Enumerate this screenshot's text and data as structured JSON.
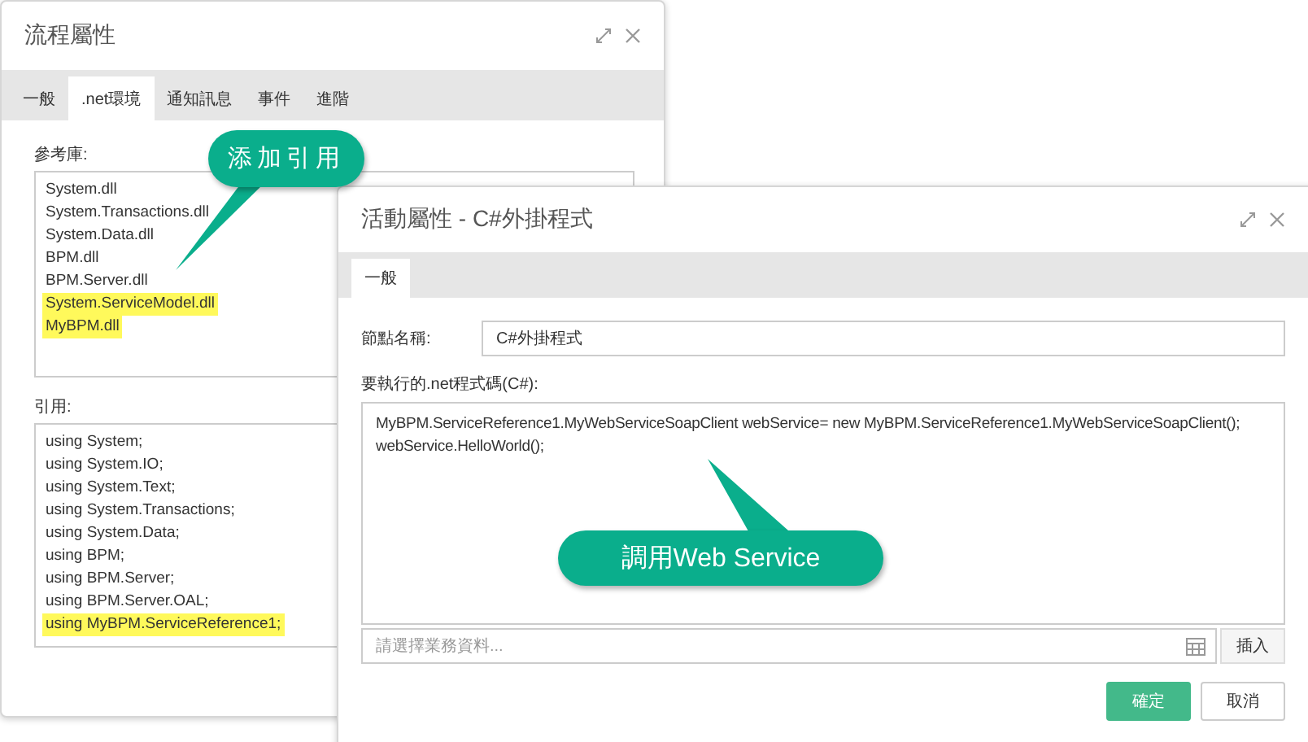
{
  "process_dialog": {
    "title": "流程屬性",
    "tabs": [
      {
        "label": "一般",
        "selected": false
      },
      {
        "label": ".net環境",
        "selected": true
      },
      {
        "label": "通知訊息",
        "selected": false
      },
      {
        "label": "事件",
        "selected": false
      },
      {
        "label": "進階",
        "selected": false
      }
    ],
    "references_label": "參考庫:",
    "references": [
      {
        "text": "System.dll",
        "highlighted": false
      },
      {
        "text": "System.Transactions.dll",
        "highlighted": false
      },
      {
        "text": "System.Data.dll",
        "highlighted": false
      },
      {
        "text": "BPM.dll",
        "highlighted": false
      },
      {
        "text": "BPM.Server.dll",
        "highlighted": false
      },
      {
        "text": "System.ServiceModel.dll",
        "highlighted": true
      },
      {
        "text": "MyBPM.dll",
        "highlighted": true
      }
    ],
    "usings_label": "引用:",
    "usings": [
      {
        "text": "using System;",
        "highlighted": false
      },
      {
        "text": "using System.IO;",
        "highlighted": false
      },
      {
        "text": "using System.Text;",
        "highlighted": false
      },
      {
        "text": "using System.Transactions;",
        "highlighted": false
      },
      {
        "text": "using System.Data;",
        "highlighted": false
      },
      {
        "text": "using BPM;",
        "highlighted": false
      },
      {
        "text": "using BPM.Server;",
        "highlighted": false
      },
      {
        "text": "using BPM.Server.OAL;",
        "highlighted": false
      },
      {
        "text": "using MyBPM.ServiceReference1;",
        "highlighted": true
      }
    ]
  },
  "activity_dialog": {
    "title": "活動屬性 - C#外掛程式",
    "tabs": [
      {
        "label": "一般",
        "selected": true
      }
    ],
    "node_name_label": "節點名稱:",
    "node_name": "C#外掛程式",
    "code_label": "要執行的.net程式碼(C#):",
    "code_lines": [
      "MyBPM.ServiceReference1.MyWebServiceSoapClient webService= new MyBPM.ServiceReference1.MyWebServiceSoapClient();",
      "webService.HelloWorld();"
    ],
    "data_field": {
      "placeholder": "請選擇業務資料..."
    },
    "insert_button": "插入",
    "buttons": [
      {
        "label": "確定",
        "primary": true
      },
      {
        "label": "取消",
        "primary": false
      }
    ]
  },
  "callouts": [
    {
      "text": "添加引用"
    },
    {
      "text": "調用Web Service"
    }
  ]
}
